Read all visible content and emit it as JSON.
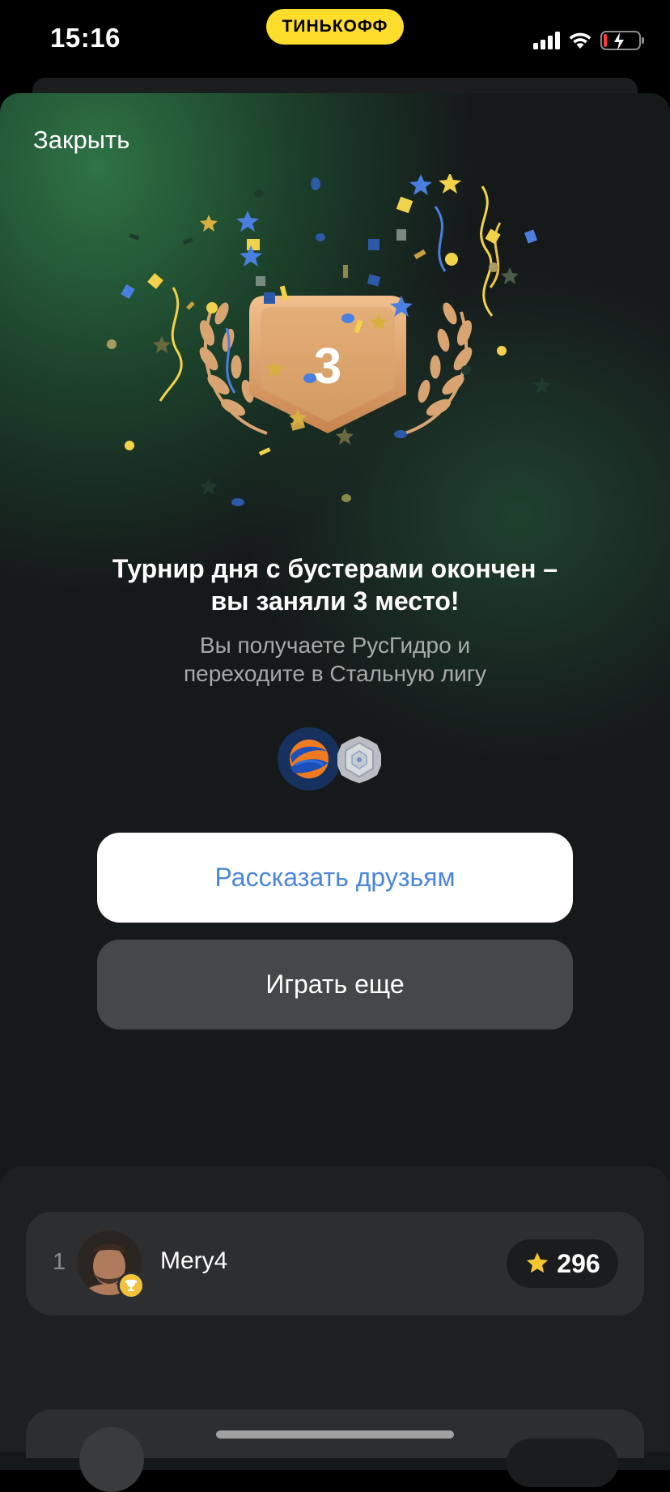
{
  "status_bar": {
    "time": "15:16",
    "brand": "ТИНЬКОФФ"
  },
  "header": {
    "close_label": "Закрыть"
  },
  "result": {
    "place": "3",
    "title_line1": "Турнир дня с бустерами окончен –",
    "title_line2": "вы заняли 3 место!",
    "subtitle_line1": "Вы получаете РусГидро и",
    "subtitle_line2": "переходите в Стальную лигу"
  },
  "actions": {
    "share_label": "Рассказать друзьям",
    "play_again_label": "Играть еще"
  },
  "leaderboard": {
    "rows": [
      {
        "rank": "1",
        "name": "Mery4",
        "score": "296"
      }
    ]
  },
  "colors": {
    "brand_yellow": "#ffdd2d",
    "link_blue": "#4b86d8",
    "medal_bronze": "#d9a36e",
    "background_green": "#2f7046"
  }
}
